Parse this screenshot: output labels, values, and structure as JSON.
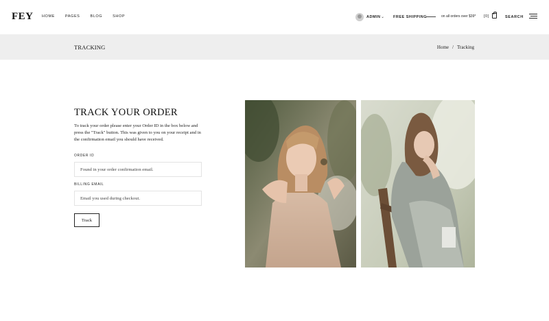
{
  "header": {
    "logo": "FEY",
    "nav": [
      "HOME",
      "PAGES",
      "BLOG",
      "SHOP"
    ],
    "user": "ADMIN",
    "free_shipping": "FREE SHIPPING",
    "free_note": "on all orders over $39*",
    "cart_count": "[0]",
    "search": "SEARCH"
  },
  "titlebar": {
    "title": "TRACKING",
    "breadcrumb": [
      "Home",
      "/",
      "Tracking"
    ]
  },
  "form": {
    "heading": "TRACK YOUR ORDER",
    "description": "To track your order please enter your Order ID in the box below and press the \"Track\" button. This was given to you on your receipt and in the confirmation email you should have received.",
    "order_id_label": "ORDER ID",
    "order_id_placeholder": "Found in your order confirmation email.",
    "billing_label": "BILLING EMAIL",
    "billing_placeholder": "Email you used during checkout.",
    "button": "Track"
  },
  "icons": {
    "avatar": "user-avatar",
    "chevron": "chevron-down-icon",
    "bag": "shopping-bag-icon",
    "menu": "hamburger-menu-icon"
  },
  "colors": {
    "titlebar_bg": "#eeeeee",
    "text": "#1a1a1a",
    "border": "#e3e3e3"
  }
}
